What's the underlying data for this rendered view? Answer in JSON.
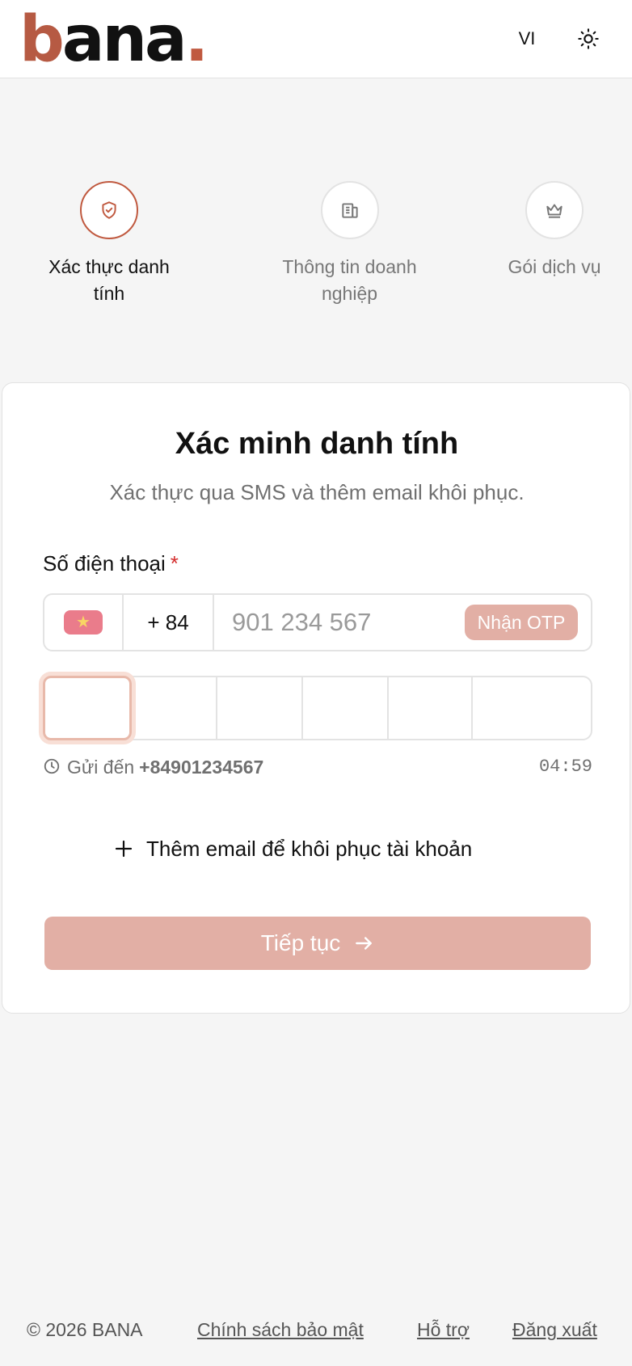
{
  "header": {
    "logo_parts": {
      "b": "b",
      "rest": "ana",
      "dot": "."
    },
    "language": "VI",
    "theme_icon": "sun-icon"
  },
  "steps": [
    {
      "label": "Xác thực danh tính",
      "icon": "shield-check-icon",
      "active": true
    },
    {
      "label": "Thông tin doanh nghiệp",
      "icon": "building-icon",
      "active": false
    },
    {
      "label": "Gói dịch vụ",
      "icon": "crown-icon",
      "active": false
    }
  ],
  "card": {
    "title": "Xác minh danh tính",
    "subtitle": "Xác thực qua SMS và thêm email khôi phục.",
    "phone_label": "Số điện thoại",
    "required_mark": "*",
    "flag_icon": "vietnam-flag-icon",
    "dial_code": "+ 84",
    "phone_placeholder": "901 234 567",
    "phone_value": "",
    "otp_button": "Nhận OTP",
    "otp_cells": [
      "",
      "",
      "",
      "",
      "",
      ""
    ],
    "sent_prefix": "Gửi đến",
    "sent_number": "+84901234567",
    "timer": "04:59",
    "add_email": "Thêm email để khôi phục tài khoản",
    "continue_button": "Tiếp tục"
  },
  "footer": {
    "copyright": "© 2026 BANA",
    "privacy": "Chính sách bảo mật",
    "support": "Hỗ trợ",
    "logout": "Đăng xuất"
  },
  "colors": {
    "brand": "#c0593f",
    "button_disabled": "#e2afa5",
    "required": "#d42d2d",
    "border": "#e3e3e3"
  }
}
